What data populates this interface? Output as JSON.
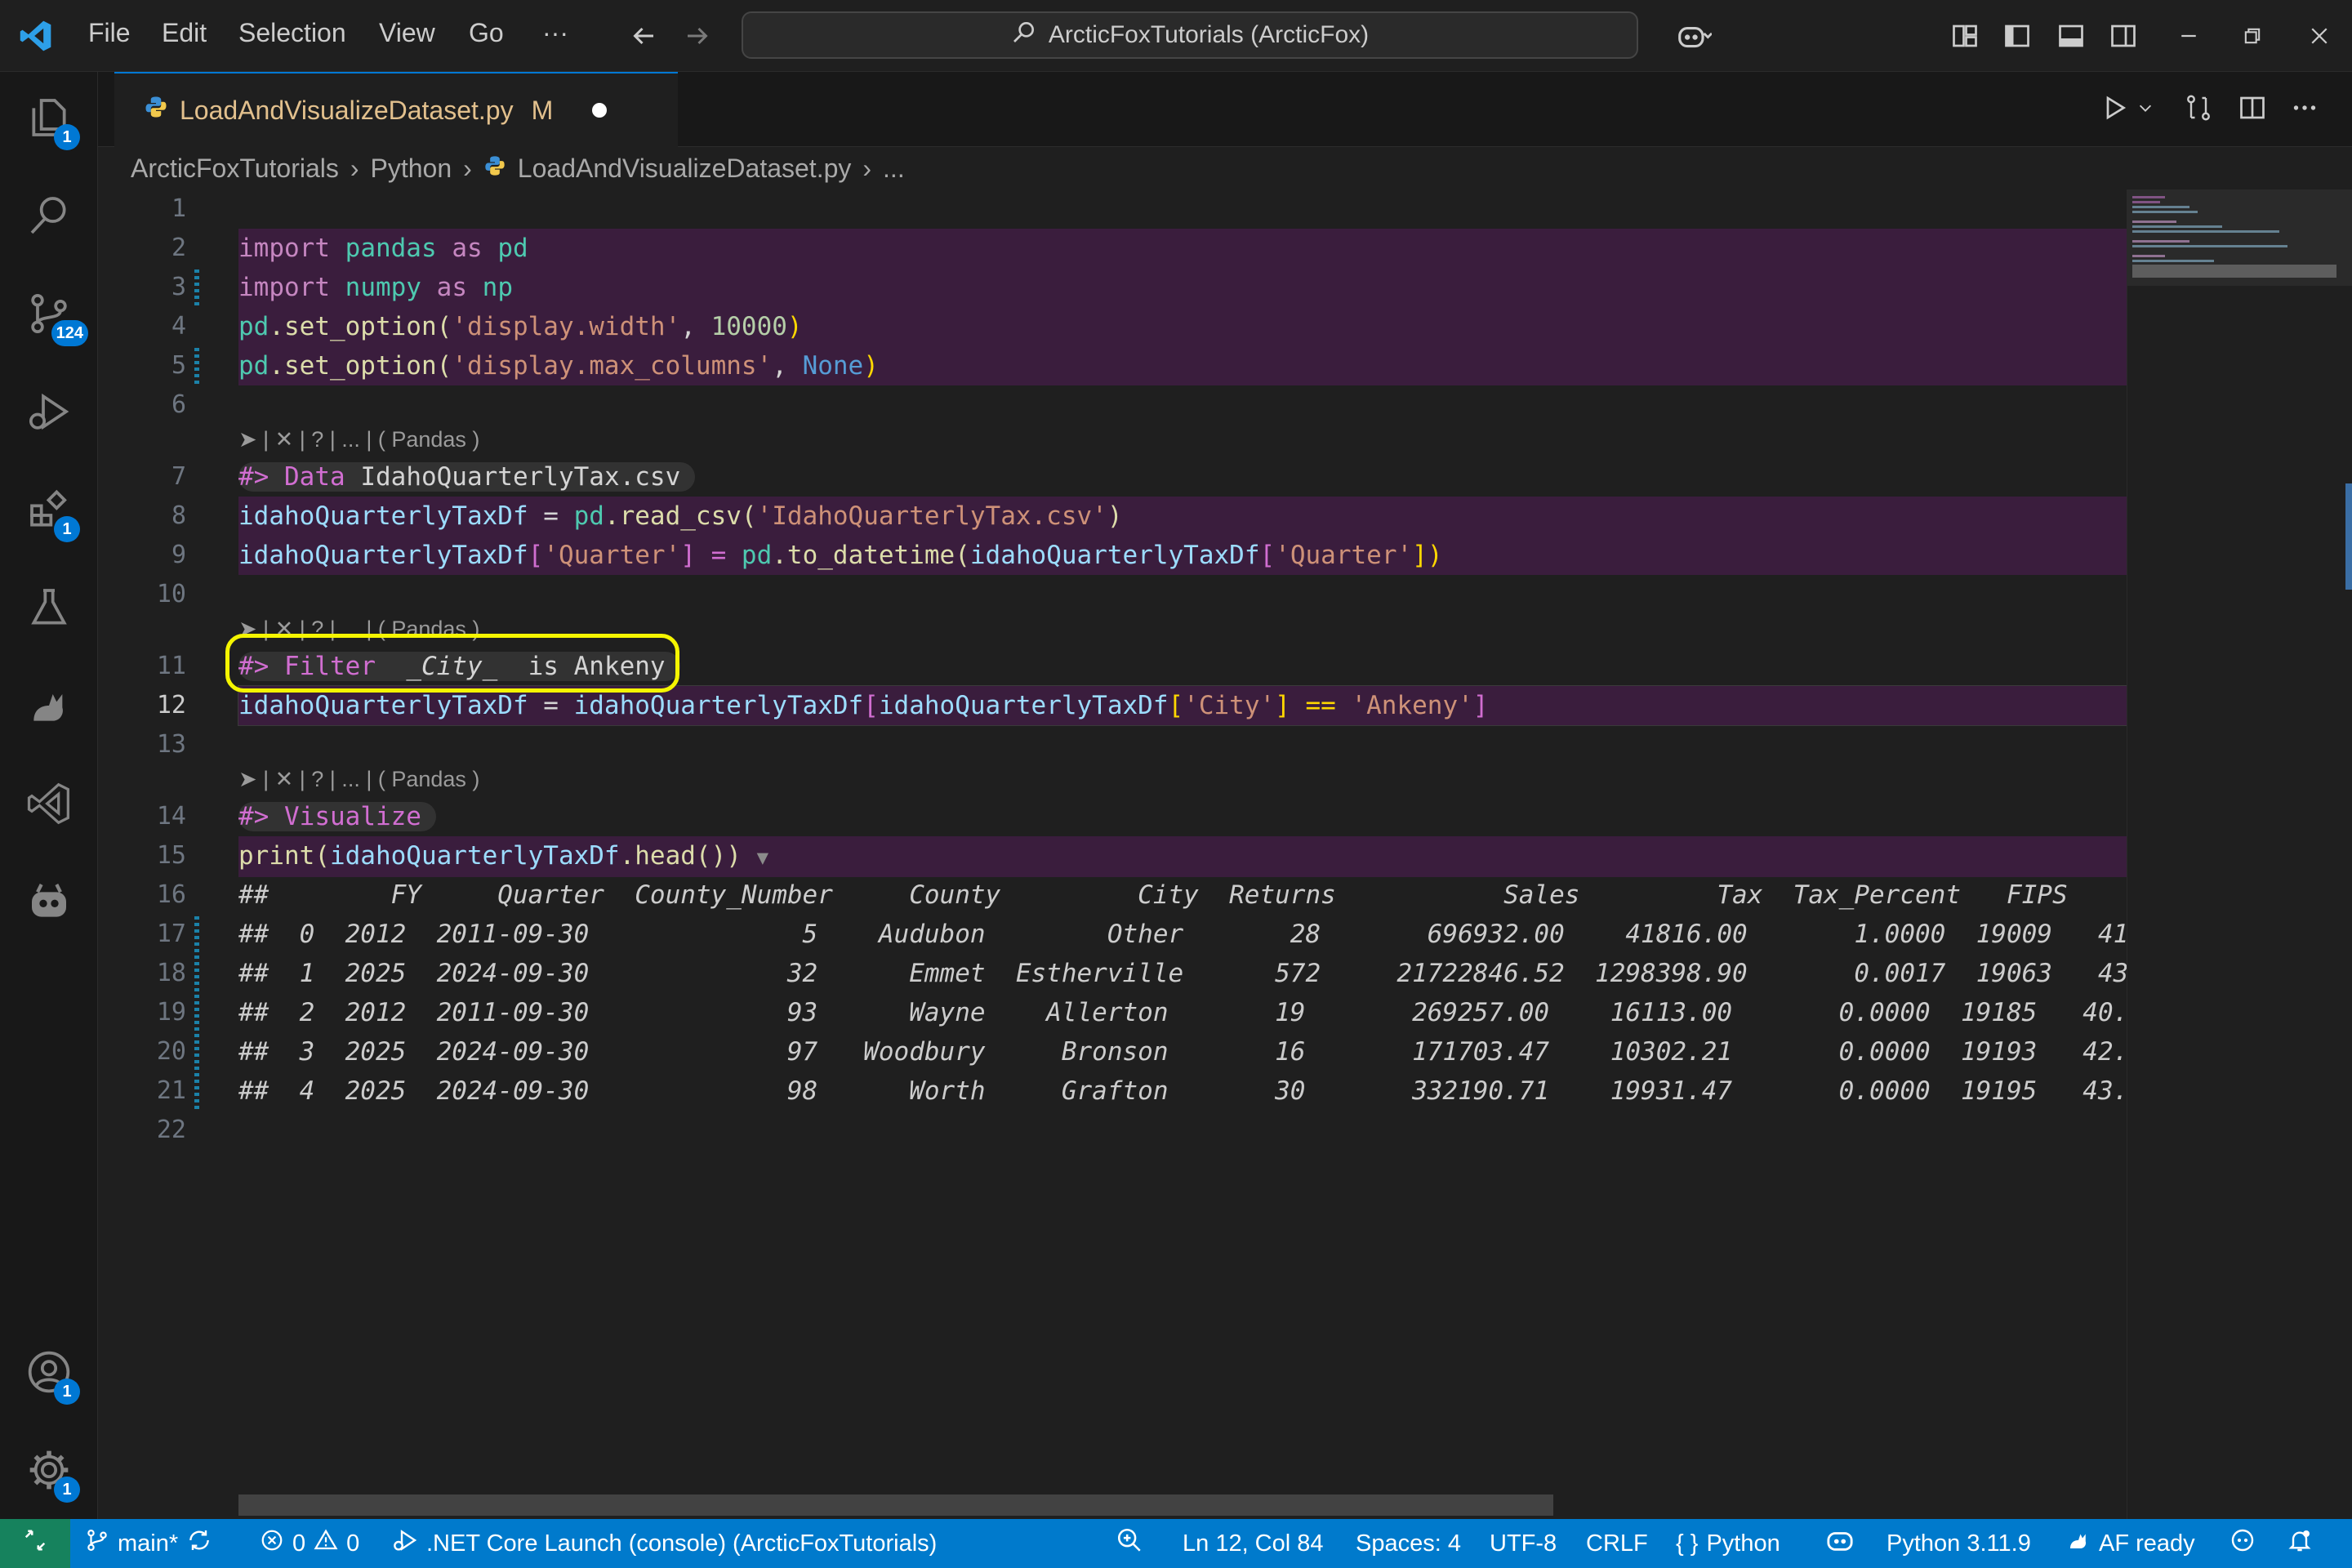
{
  "titlebar": {
    "menu": [
      "File",
      "Edit",
      "Selection",
      "View",
      "Go"
    ],
    "more": "···",
    "search_text": "ArcticFoxTutorials (ArcticFox)"
  },
  "activity": {
    "explorer_badge": "1",
    "scm_badge": "124",
    "extensions_badge": "1",
    "accounts_badge": "1",
    "settings_badge": "1"
  },
  "tab": {
    "filename": "LoadAndVisualizeDataset.py",
    "status": "M"
  },
  "breadcrumb": [
    "ArcticFoxTutorials",
    "Python",
    "LoadAndVisualizeDataset.py",
    "..."
  ],
  "codelens": "➤ | ✕ | ? | ... | ( Pandas )",
  "code": {
    "l2": [
      "import",
      "pandas",
      "as",
      "pd"
    ],
    "l3": [
      "import",
      "numpy",
      "as",
      "np"
    ],
    "l4": [
      "pd",
      ".set_option(",
      "'display.width'",
      ", ",
      "10000",
      ")"
    ],
    "l5": [
      "pd",
      ".set_option(",
      "'display.max_columns'",
      ", ",
      "None",
      ")"
    ],
    "l7": [
      "#>",
      "Data",
      "IdahoQuarterlyTax.csv"
    ],
    "l8": [
      "idahoQuarterlyTaxDf",
      " = ",
      "pd",
      ".read_csv(",
      "'IdahoQuarterlyTax.csv'",
      ")"
    ],
    "l9": [
      "idahoQuarterlyTaxDf",
      "[",
      "'Quarter'",
      "] = ",
      "pd",
      ".to_datetime(",
      "idahoQuarterlyTaxDf",
      "[",
      "'Quarter'",
      "])"
    ],
    "l11": [
      "#>",
      "Filter",
      "_City_",
      "is Ankeny"
    ],
    "l12": [
      "idahoQuarterlyTaxDf",
      " = ",
      "idahoQuarterlyTaxDf",
      "[",
      "idahoQuarterlyTaxDf",
      "[",
      "'City'",
      "] == ",
      "'Ankeny'",
      "]"
    ],
    "l14": [
      "#>",
      "Visualize"
    ],
    "l15": [
      "print(",
      "idahoQuarterlyTaxDf",
      ".head()",
      ")"
    ],
    "output": [
      "##        FY     Quarter  County_Number     County         City  Returns           Sales         Tax  Tax_Percent   FIPS",
      "##  0  2012  2011-09-30              5    Audubon        Other       28       696932.00    41816.00       1.0000  19009   41.",
      "##  1  2025  2024-09-30             32      Emmet  Estherville      572     21722846.52  1298398.90       0.0017  19063   43.",
      "##  2  2012  2011-09-30             93      Wayne    Allerton       19       269257.00    16113.00       0.0000  19185   40.",
      "##  3  2025  2024-09-30             97   Woodbury     Bronson       16       171703.47    10302.21       0.0000  19193   42.",
      "##  4  2025  2024-09-30             98      Worth     Grafton       30       332190.71    19931.47       0.0000  19195   43."
    ]
  },
  "status": {
    "branch": "main*",
    "errors": "0",
    "warnings": "0",
    "launch": ".NET Core Launch (console) (ArcticFoxTutorials)",
    "position": "Ln 12, Col 84",
    "spaces": "Spaces: 4",
    "encoding": "UTF-8",
    "eol": "CRLF",
    "language": "Python",
    "interpreter": "Python 3.11.9",
    "af": "AF ready"
  },
  "colors": {
    "statusbar": "#007acc",
    "accent": "#0078d4",
    "highlight": "#f5f500",
    "cell": "#3a1d3d"
  }
}
